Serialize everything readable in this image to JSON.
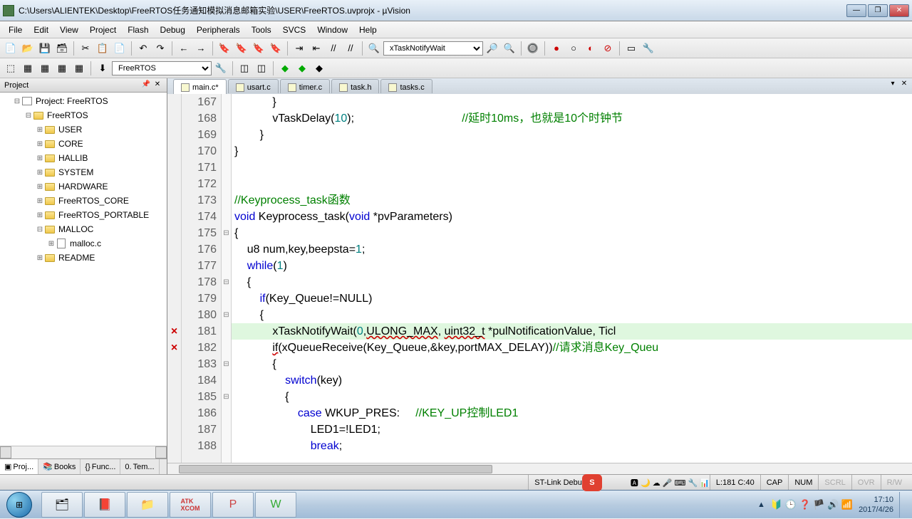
{
  "window": {
    "title": "C:\\Users\\ALIENTEK\\Desktop\\FreeRTOS任务通知模拟消息邮箱实验\\USER\\FreeRTOS.uvprojx - µVision"
  },
  "menu": [
    "File",
    "Edit",
    "View",
    "Project",
    "Flash",
    "Debug",
    "Peripherals",
    "Tools",
    "SVCS",
    "Window",
    "Help"
  ],
  "toolbar": {
    "func_combo": "xTaskNotifyWait",
    "target_combo": "FreeRTOS"
  },
  "project_panel": {
    "title": "Project",
    "root": "Project: FreeRTOS",
    "target": "FreeRTOS",
    "groups": [
      "USER",
      "CORE",
      "HALLIB",
      "SYSTEM",
      "HARDWARE",
      "FreeRTOS_CORE",
      "FreeRTOS_PORTABLE"
    ],
    "open_group": "MALLOC",
    "open_file": "malloc.c",
    "last_group": "README",
    "tabs": [
      "Proj...",
      "Books",
      "Func...",
      "Tem..."
    ]
  },
  "editor": {
    "tabs": [
      {
        "label": "main.c*",
        "active": true
      },
      {
        "label": "usart.c",
        "active": false
      },
      {
        "label": "timer.c",
        "active": false
      },
      {
        "label": "task.h",
        "active": false
      },
      {
        "label": "tasks.c",
        "active": false
      }
    ],
    "first_line": 167,
    "lines": [
      {
        "n": 167,
        "fold": "",
        "err": "",
        "html": "            }"
      },
      {
        "n": 168,
        "fold": "",
        "err": "",
        "html": "            vTaskDelay(<span class='num'>10</span>);                                  <span class='cmt'>//延时10ms，也就是10个时钟节</span>"
      },
      {
        "n": 169,
        "fold": "",
        "err": "",
        "html": "        }"
      },
      {
        "n": 170,
        "fold": "",
        "err": "",
        "html": "}"
      },
      {
        "n": 171,
        "fold": "",
        "err": "",
        "html": ""
      },
      {
        "n": 172,
        "fold": "",
        "err": "",
        "html": ""
      },
      {
        "n": 173,
        "fold": "",
        "err": "",
        "html": "<span class='cmt'>//Keyprocess_task函数</span>"
      },
      {
        "n": 174,
        "fold": "",
        "err": "",
        "html": "<span class='kw'>void</span> Keyprocess_task(<span class='kw'>void</span> *pvParameters)"
      },
      {
        "n": 175,
        "fold": "⊟",
        "err": "",
        "html": "{"
      },
      {
        "n": 176,
        "fold": "",
        "err": "",
        "html": "    u8 num,key,beepsta=<span class='num'>1</span>;"
      },
      {
        "n": 177,
        "fold": "",
        "err": "",
        "html": "    <span class='kw'>while</span>(<span class='num'>1</span>)"
      },
      {
        "n": 178,
        "fold": "⊟",
        "err": "",
        "html": "    {"
      },
      {
        "n": 179,
        "fold": "",
        "err": "",
        "html": "        <span class='kw'>if</span>(Key_Queue!=NULL)"
      },
      {
        "n": 180,
        "fold": "⊟",
        "err": "",
        "html": "        {"
      },
      {
        "n": 181,
        "fold": "",
        "err": "×",
        "hl": true,
        "html": "            xTaskNotifyWait(<span class='num'>0</span>,<span class='err-udl'>ULONG_MAX</span>, <span class='err-udl'>uint32_t</span> *pulNotificationValue, Ticl"
      },
      {
        "n": 182,
        "fold": "",
        "err": "×",
        "html": "            <span class='err-udl'>if</span>(xQueueReceive(Key_Queue,&key,portMAX_DELAY))<span class='cmt'>//请求消息Key_Queu</span>"
      },
      {
        "n": 183,
        "fold": "⊟",
        "err": "",
        "html": "            {"
      },
      {
        "n": 184,
        "fold": "",
        "err": "",
        "html": "                <span class='kw'>switch</span>(key)"
      },
      {
        "n": 185,
        "fold": "⊟",
        "err": "",
        "html": "                {"
      },
      {
        "n": 186,
        "fold": "",
        "err": "",
        "html": "                    <span class='kw'>case</span> WKUP_PRES:     <span class='cmt'>//KEY_UP控制LED1</span>"
      },
      {
        "n": 187,
        "fold": "",
        "err": "",
        "html": "                        LED1=!LED1;"
      },
      {
        "n": 188,
        "fold": "",
        "err": "",
        "html": "                        <span class='kw'>break</span>;"
      }
    ]
  },
  "status": {
    "left": "",
    "debug": "ST-Link Debu",
    "cursor": "L:181 C:40",
    "caps": "CAP",
    "num": "NUM",
    "scrl": "SCRL",
    "ovr": "OVR",
    "rw": "R/W"
  },
  "taskbar": {
    "time": "17:10",
    "date": "2017/4/26"
  }
}
